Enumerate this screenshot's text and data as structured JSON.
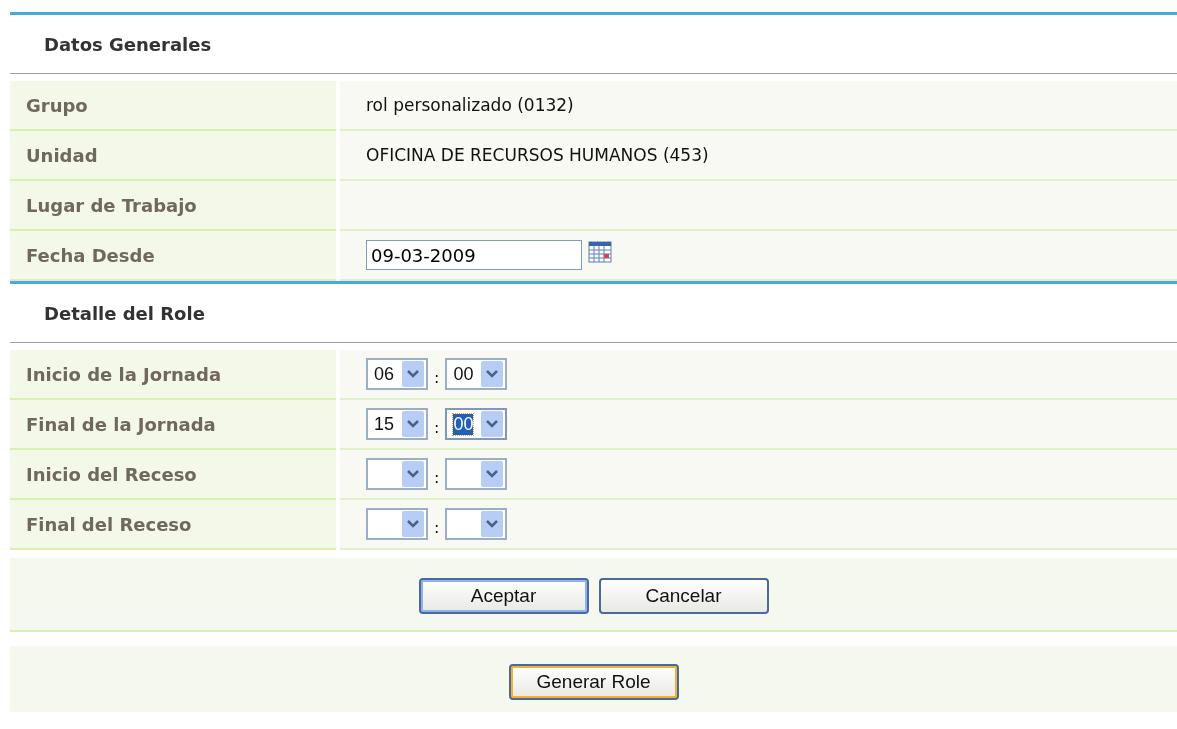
{
  "sections": [
    {
      "title": "Datos Generales",
      "rows": [
        {
          "label": "Grupo",
          "kind": "text",
          "value": "rol personalizado (0132)"
        },
        {
          "label": "Unidad",
          "kind": "text",
          "value": "OFICINA DE RECURSOS HUMANOS (453)"
        },
        {
          "label": "Lugar de Trabajo",
          "kind": "empty"
        },
        {
          "label": "Fecha Desde",
          "kind": "date",
          "value": "09-03-2009"
        }
      ]
    },
    {
      "title": "Detalle del Role",
      "rows": [
        {
          "label": "Inicio de la Jornada",
          "kind": "time",
          "separator": ":",
          "hour": {
            "value": "06",
            "focused": false
          },
          "minute": {
            "value": "00",
            "focused": false
          }
        },
        {
          "label": "Final de la Jornada",
          "kind": "time",
          "separator": ":",
          "hour": {
            "value": "15",
            "focused": false
          },
          "minute": {
            "value": "00",
            "focused": true
          }
        },
        {
          "label": "Inicio del Receso",
          "kind": "time",
          "separator": ":",
          "hour": {
            "focused": false
          },
          "minute": {
            "focused": false
          }
        },
        {
          "label": "Final del Receso",
          "kind": "time",
          "separator": ":",
          "hour": {
            "focused": false
          },
          "minute": {
            "focused": false
          }
        }
      ],
      "buttons": [
        {
          "label": "Aceptar",
          "default": true,
          "hot": false
        },
        {
          "label": "Cancelar",
          "default": false,
          "hot": false
        }
      ]
    }
  ],
  "footer_buttons": [
    {
      "label": "Generar Role",
      "default": false,
      "hot": true
    }
  ]
}
